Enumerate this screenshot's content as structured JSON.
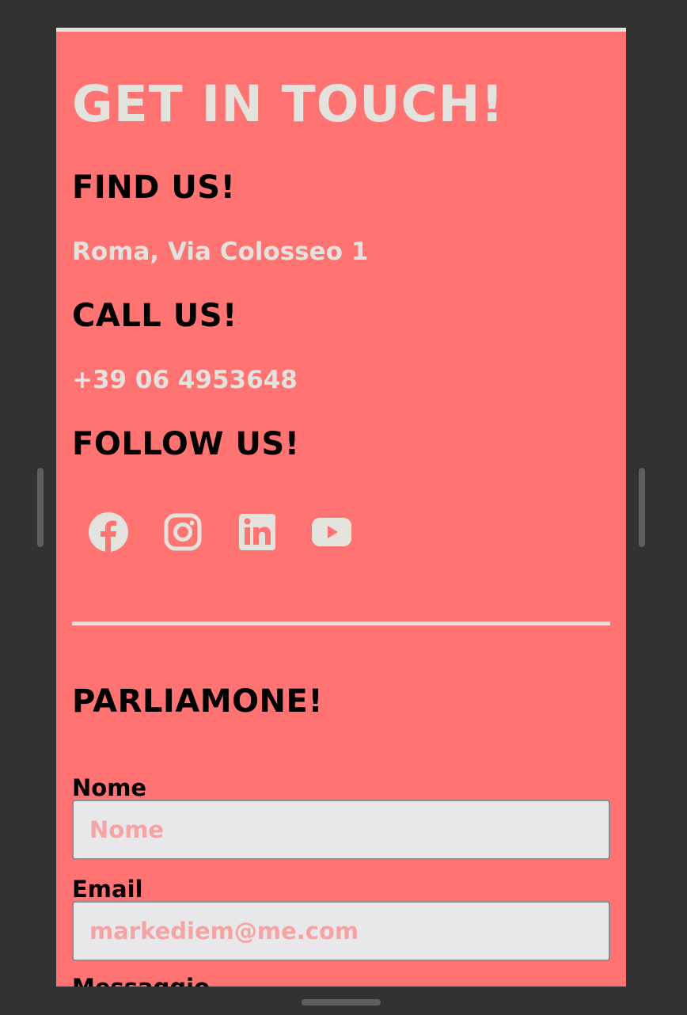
{
  "page_title": "GET IN TOUCH!",
  "find_us": {
    "heading": "FIND US!",
    "address": "Roma, Via Colosseo 1"
  },
  "call_us": {
    "heading": "CALL US!",
    "phone": "+39 06 4953648"
  },
  "follow_us": {
    "heading": "FOLLOW US!",
    "icons": [
      "facebook-icon",
      "instagram-icon",
      "linkedin-icon",
      "youtube-icon"
    ]
  },
  "contact_form": {
    "heading": "PARLIAMONE!",
    "name_label": "Nome",
    "name_placeholder": "Nome",
    "email_label": "Email",
    "email_placeholder": "markediem@me.com",
    "message_label": "Messaggio"
  },
  "colors": {
    "background": "#ff7373",
    "accent_text": "#e4e2dc",
    "heading_text": "#000000",
    "frame": "#323232"
  }
}
